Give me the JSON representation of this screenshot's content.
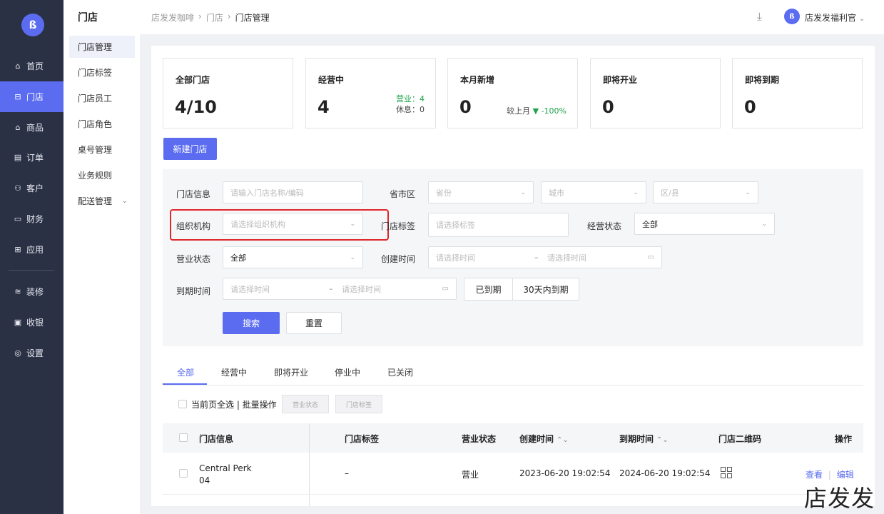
{
  "app": {
    "logo_text": "ß"
  },
  "nav": {
    "items": [
      {
        "icon": "⌂",
        "label": "首页"
      },
      {
        "icon": "⊟",
        "label": "门店"
      },
      {
        "icon": "⌂",
        "label": "商品"
      },
      {
        "icon": "▤",
        "label": "订单"
      },
      {
        "icon": "⚇",
        "label": "客户"
      },
      {
        "icon": "▭",
        "label": "财务"
      },
      {
        "icon": "⊞",
        "label": "应用"
      },
      {
        "icon": "≋",
        "label": "装修"
      },
      {
        "icon": "▣",
        "label": "收银"
      },
      {
        "icon": "◎",
        "label": "设置"
      }
    ],
    "active_index": 1
  },
  "subnav": {
    "title": "门店",
    "items": [
      "门店管理",
      "门店标签",
      "门店员工",
      "门店角色",
      "桌号管理",
      "业务规则",
      "配送管理"
    ],
    "active_index": 0
  },
  "header": {
    "breadcrumb": [
      "店发发咖啡",
      "门店",
      "门店管理"
    ],
    "separator": "›",
    "user_name": "店发发福利官",
    "avatar_text": "ß"
  },
  "stats": [
    {
      "label": "全部门店",
      "value": "4/10"
    },
    {
      "label": "经营中",
      "value": "4",
      "side1": "营业：4",
      "side2": "休息：0"
    },
    {
      "label": "本月新增",
      "value": "0",
      "compare_label": "较上月",
      "compare_value": "▼ -100%"
    },
    {
      "label": "即将开业",
      "value": "0"
    },
    {
      "label": "即将到期",
      "value": "0"
    }
  ],
  "new_store_button": "新建门店",
  "filters": {
    "store_info_label": "门店信息",
    "store_info_placeholder": "请输入门店名称/编码",
    "region_label": "省市区",
    "province_placeholder": "省份",
    "city_placeholder": "城市",
    "district_placeholder": "区/县",
    "org_label": "组织机构",
    "org_placeholder": "请选择组织机构",
    "tag_label": "门店标签",
    "tag_placeholder": "请选择标签",
    "op_status_label": "经营状态",
    "op_status_value": "全部",
    "biz_status_label": "营业状态",
    "biz_status_value": "全部",
    "created_label": "创建时间",
    "created_start": "请选择时间",
    "created_end": "请选择时间",
    "expire_label": "到期时间",
    "expire_start": "请选择时间",
    "expire_end": "请选择时间",
    "range_dash": "–",
    "expired_button": "已到期",
    "expire30_button": "30天内到期",
    "search_button": "搜索",
    "reset_button": "重置"
  },
  "tabs": [
    "全部",
    "经营中",
    "即将开业",
    "停业中",
    "已关闭"
  ],
  "active_tab": 0,
  "bulk": {
    "label": "当前页全选 | 批量操作",
    "status_button": "营业状态",
    "tag_button": "门店标签"
  },
  "table": {
    "columns": [
      "门店信息",
      "门店标签",
      "营业状态",
      "创建时间",
      "到期时间",
      "门店二维码",
      "操作"
    ],
    "sort_icon": "⌃⌄",
    "rows": [
      {
        "name": "Central Perk",
        "code": "04",
        "tags": "–",
        "status": "营业",
        "created": "2023-06-20 19:02:54",
        "expires": "2024-06-20 19:02:54",
        "action_view": "查看",
        "action_sep": "|",
        "action_edit": "编辑"
      }
    ]
  },
  "watermark": "店发发",
  "colors": {
    "accent": "#5b6cf0",
    "sidebar": "#2b3145",
    "success": "#1ca34a",
    "highlight": "#e0262a"
  }
}
